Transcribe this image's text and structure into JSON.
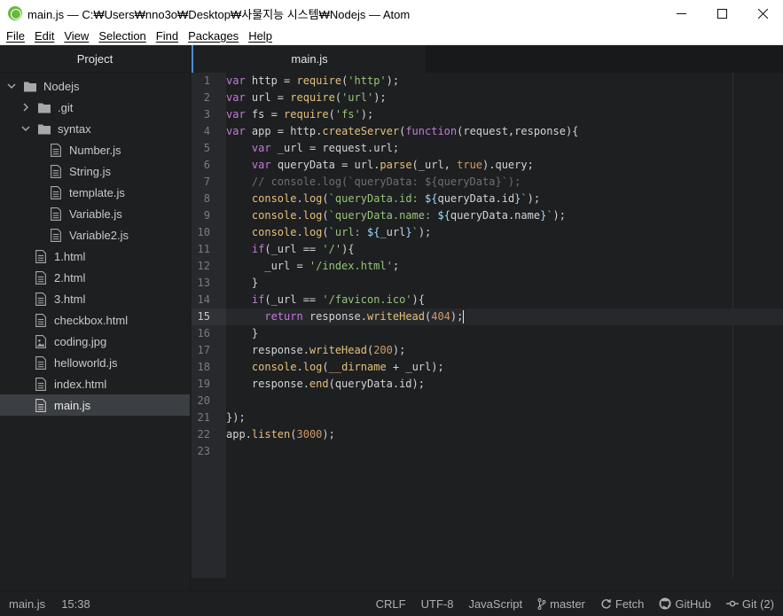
{
  "window": {
    "title": "main.js — C:₩Users₩nno3o₩Desktop₩사물지능 시스템₩Nodejs — Atom",
    "minimize": "—",
    "maximize": "☐",
    "close": "✕"
  },
  "menu": [
    "File",
    "Edit",
    "View",
    "Selection",
    "Find",
    "Packages",
    "Help"
  ],
  "tree_view": {
    "header": "Project",
    "root": "Nodejs",
    "items": [
      {
        "label": ".git",
        "type": "folder",
        "expanded": false
      },
      {
        "label": "syntax",
        "type": "folder",
        "expanded": true
      },
      {
        "label": "Number.js",
        "type": "file"
      },
      {
        "label": "String.js",
        "type": "file"
      },
      {
        "label": "template.js",
        "type": "file"
      },
      {
        "label": "Variable.js",
        "type": "file"
      },
      {
        "label": "Variable2.js",
        "type": "file"
      },
      {
        "label": "1.html",
        "type": "file"
      },
      {
        "label": "2.html",
        "type": "file"
      },
      {
        "label": "3.html",
        "type": "file"
      },
      {
        "label": "checkbox.html",
        "type": "file"
      },
      {
        "label": "coding.jpg",
        "type": "image"
      },
      {
        "label": "helloworld.js",
        "type": "file"
      },
      {
        "label": "index.html",
        "type": "file"
      },
      {
        "label": "main.js",
        "type": "file",
        "selected": true
      }
    ]
  },
  "tabs": [
    {
      "label": "main.js",
      "active": true
    }
  ],
  "editor": {
    "line_numbers": [
      "1",
      "2",
      "3",
      "4",
      "5",
      "6",
      "7",
      "8",
      "9",
      "10",
      "11",
      "12",
      "13",
      "14",
      "15",
      "16",
      "17",
      "18",
      "19",
      "20",
      "21",
      "22",
      "23"
    ],
    "active_line": 15,
    "lines": [
      "var http = require('http');",
      "var url = require('url');",
      "var fs = require('fs');",
      "var app = http.createServer(function(request,response){",
      "    var _url = request.url;",
      "    var queryData = url.parse(_url, true).query;",
      "    // console.log(`queryData: ${queryData}`);",
      "    console.log(`queryData.id: ${queryData.id}`);",
      "    console.log(`queryData.name: ${queryData.name}`);",
      "    console.log(`url: ${_url}`);",
      "    if(_url == '/'){",
      "      _url = '/index.html';",
      "    }",
      "    if(_url == '/favicon.ico'){",
      "      return response.writeHead(404);",
      "    }",
      "    response.writeHead(200);",
      "    console.log(__dirname + _url);",
      "    response.end(queryData.id);",
      "",
      "});",
      "app.listen(3000);",
      ""
    ]
  },
  "status_bar": {
    "file": "main.js",
    "cursor": "15:38",
    "line_ending": "CRLF",
    "encoding": "UTF-8",
    "grammar": "JavaScript",
    "branch": "master",
    "fetch": "Fetch",
    "github": "GitHub",
    "git": "Git (2)"
  },
  "colors": {
    "background": "#1d1f21",
    "gutter": "#27292c",
    "keyword": "#c678dd",
    "string": "#98c379",
    "number": "#d19a66",
    "function": "#e5c07b",
    "comment": "#6b6f76",
    "accent": "#4e8fd0"
  }
}
